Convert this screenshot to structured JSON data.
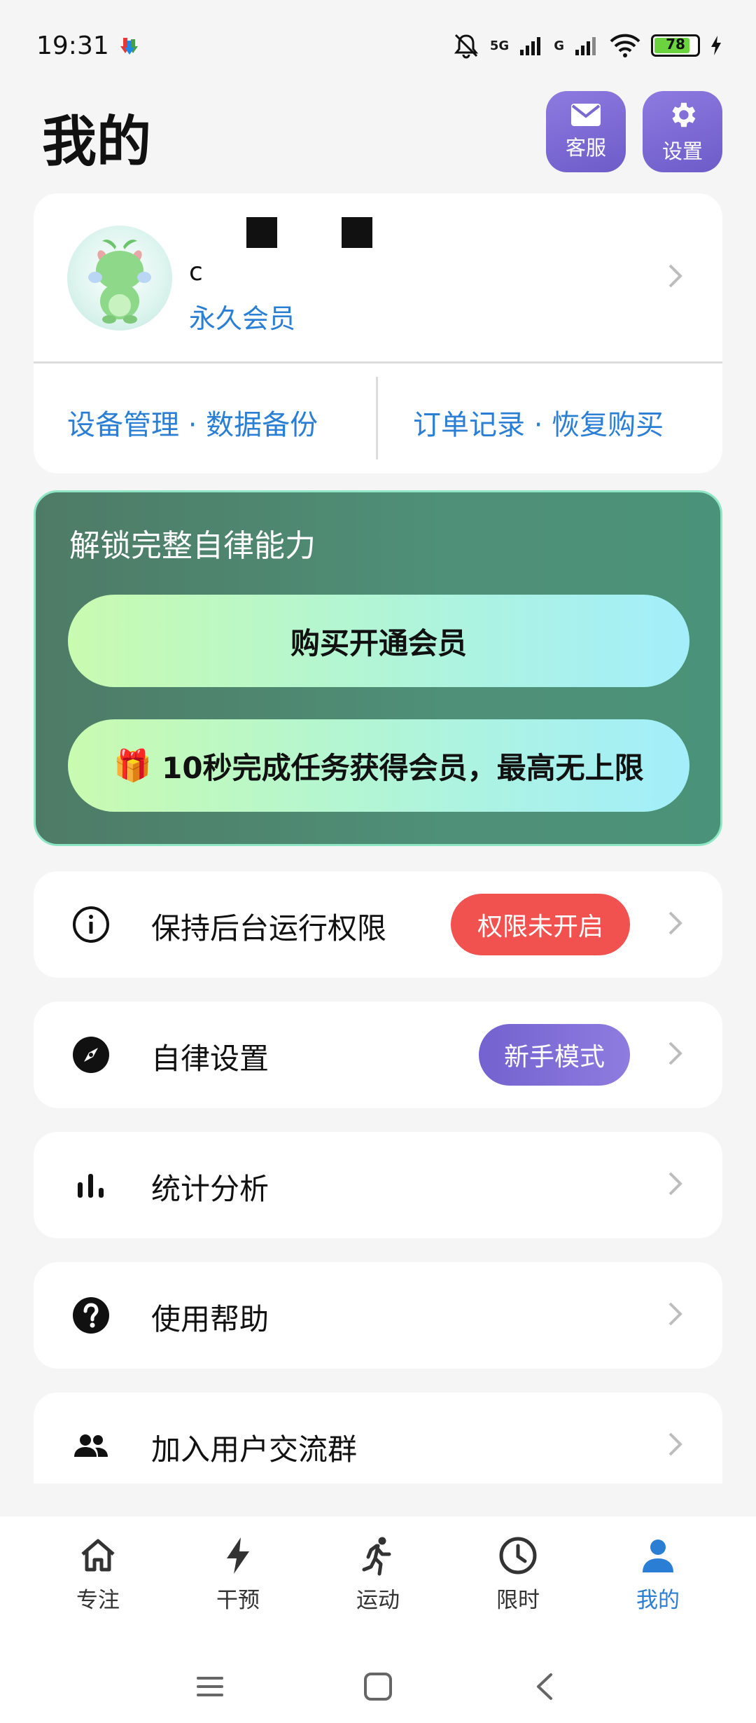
{
  "status_bar": {
    "time": "19:31",
    "network_1": "5G",
    "network_2": "G",
    "battery": "78"
  },
  "header": {
    "title": "我的",
    "service_label": "客服",
    "settings_label": "设置"
  },
  "profile": {
    "name_partial": "c",
    "membership": "永久会员",
    "link_left": "设备管理 · 数据备份",
    "link_right": "订单记录 · 恢复购买"
  },
  "promo": {
    "title": "解锁完整自律能力",
    "buy_button": "购买开通会员",
    "task_button": "10秒完成任务获得会员，最高无上限",
    "task_icon": "🎁"
  },
  "menu": {
    "items": [
      {
        "label": "保持后台运行权限",
        "icon": "info-icon",
        "badge": "权限未开启"
      },
      {
        "label": "自律设置",
        "icon": "compass-icon",
        "badge": "新手模式"
      },
      {
        "label": "统计分析",
        "icon": "bar-chart-icon"
      },
      {
        "label": "使用帮助",
        "icon": "help-icon"
      },
      {
        "label": "加入用户交流群",
        "icon": "group-icon"
      }
    ]
  },
  "bottom_nav": {
    "items": [
      {
        "label": "专注",
        "icon": "home-icon"
      },
      {
        "label": "干预",
        "icon": "bolt-icon"
      },
      {
        "label": "运动",
        "icon": "run-icon"
      },
      {
        "label": "限时",
        "icon": "clock-icon"
      },
      {
        "label": "我的",
        "icon": "person-icon"
      }
    ],
    "active": "我的"
  },
  "colors": {
    "accent_blue": "#2a7fd4",
    "accent_purple": "#7362cf",
    "badge_red": "#f2524f",
    "promo_green": "#4f9078"
  }
}
